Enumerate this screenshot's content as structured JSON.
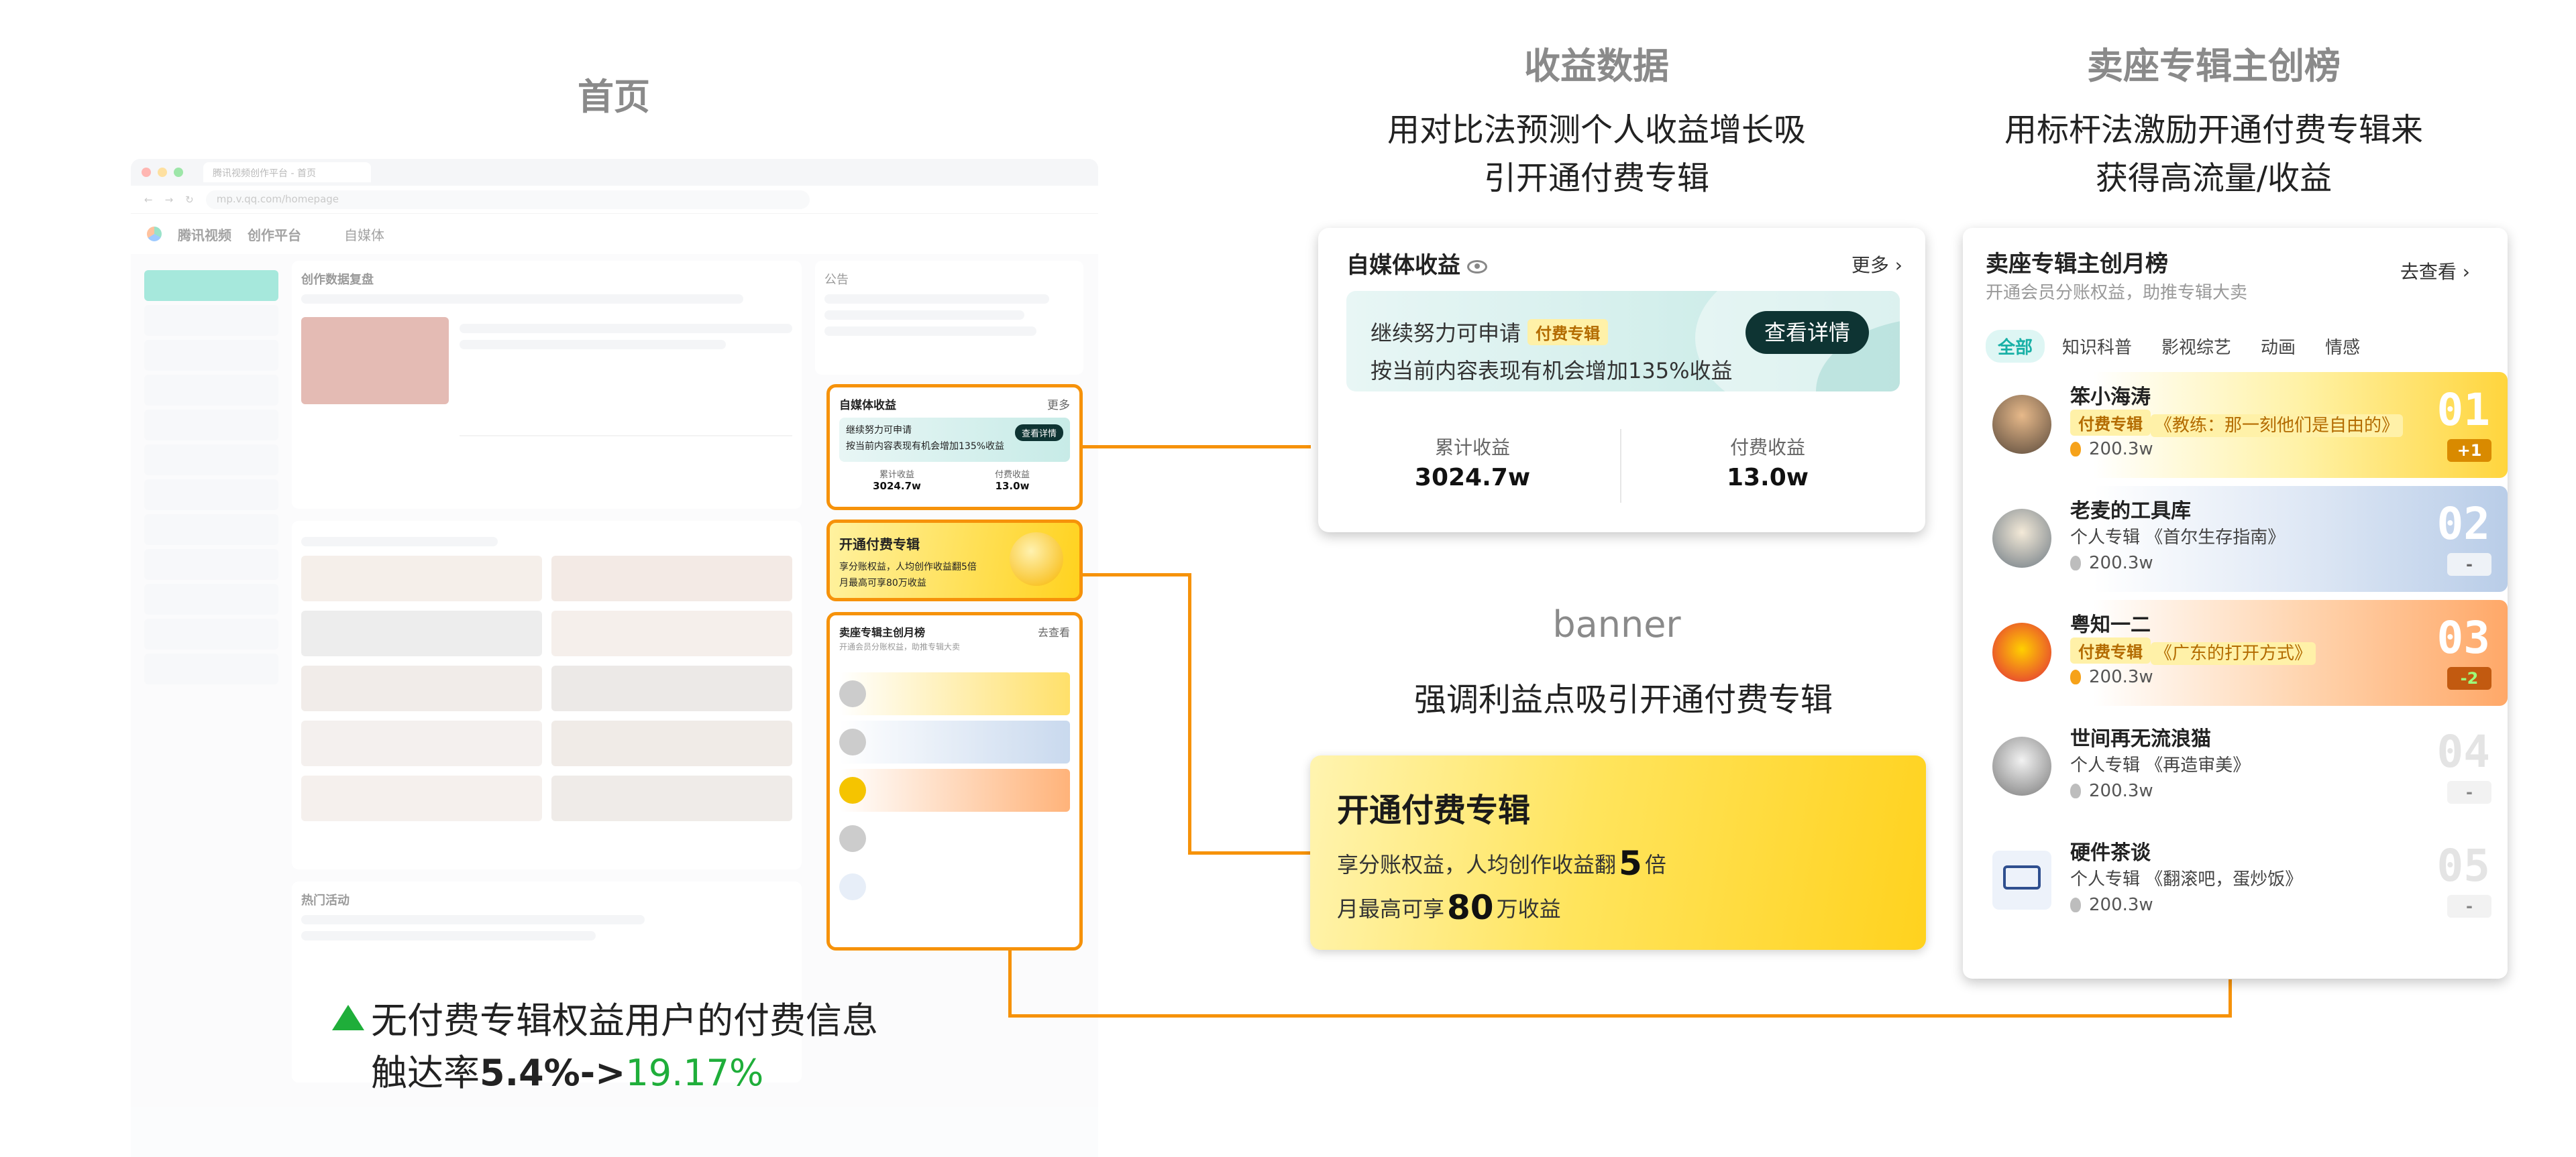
{
  "headings": {
    "home": "首页",
    "income": "收益数据",
    "income_desc_1": "用对比法预测个人收益增长吸",
    "income_desc_2": "引开通付费专辑",
    "banner": "banner",
    "banner_desc": "强调利益点吸引开通付费专辑",
    "rank": "卖座专辑主创榜",
    "rank_desc_1": "用标杆法激励开通付费专辑来",
    "rank_desc_2": "获得高流量/收益"
  },
  "mock": {
    "url": "mp.v.qq.com/homepage",
    "tab": "腾讯视频创作平台 - 首页",
    "logo": "腾讯视频",
    "platform": "创作平台",
    "nav_media": "自媒体",
    "section_data": "创作数据复盘",
    "section_notice": "公告",
    "section_hot": "热门活动",
    "income_title": "自媒体收益",
    "income_more": "更多",
    "income_line": "继续努力可申请",
    "income_line2": "按当前内容表现有机会增加135%收益",
    "income_btn": "查看详情",
    "stat1_label": "累计收益",
    "stat1_value": "3024.7w",
    "stat2_label": "付费收益",
    "stat2_value": "13.0w",
    "banner_title": "开通付费专辑",
    "banner_line1": "享分账权益，人均创作收益翻5倍",
    "banner_line2": "月最高可享80万收益",
    "rank_title": "卖座专辑主创月榜",
    "rank_sub": "开通会员分账权益，助推专辑大卖",
    "rank_go": "去查看"
  },
  "income_card": {
    "title": "自媒体收益",
    "more": "更多",
    "line1": "继续努力可申请",
    "tag": "付费专辑",
    "line2": "按当前内容表现有机会增加135%收益",
    "button": "查看详情",
    "stats": [
      {
        "label": "累计收益",
        "value": "3024.7w"
      },
      {
        "label": "付费收益",
        "value": "13.0w"
      }
    ]
  },
  "banner_card": {
    "title": "开通付费专辑",
    "line1_pre": "享分账权益，人均创作收益翻",
    "line1_num": "5",
    "line1_post": "倍",
    "line2_pre": "月最高可享",
    "line2_num": "80",
    "line2_post": "万收益"
  },
  "rank_card": {
    "title": "卖座专辑主创月榜",
    "subtitle": "开通会员分账权益，助推专辑大卖",
    "go": "去查看",
    "filters": [
      "全部",
      "知识科普",
      "影视综艺",
      "动画",
      "情感"
    ],
    "items": [
      {
        "name": "笨小海涛",
        "tag": "付费专辑",
        "album": "《教练：那一刻他们是自由的》",
        "plays": "200.3w",
        "rank": "01",
        "change": "+1"
      },
      {
        "name": "老麦的工具库",
        "tag": "个人专辑",
        "album": "《首尔生存指南》",
        "plays": "200.3w",
        "rank": "02",
        "change": "-"
      },
      {
        "name": "粤知一二",
        "tag": "付费专辑",
        "album": "《广东的打开方式》",
        "plays": "200.3w",
        "rank": "03",
        "change": "-2"
      },
      {
        "name": "世间再无流浪猫",
        "tag": "个人专辑",
        "album": "《再造审美》",
        "plays": "200.3w",
        "rank": "04",
        "change": "-"
      },
      {
        "name": "硬件茶谈",
        "tag": "个人专辑",
        "album": "《翻滚吧，蛋炒饭》",
        "plays": "200.3w",
        "rank": "05",
        "change": "-"
      }
    ]
  },
  "metric": {
    "line1": "无付费专辑权益用户的付费信息",
    "line2_pre": "触达率",
    "from": "5.4%->",
    "to": "19.17%"
  },
  "colors": {
    "accent": "#f6920a",
    "teal": "#18b0a6",
    "green": "#1fae3a",
    "gold": "#ffd21e"
  }
}
